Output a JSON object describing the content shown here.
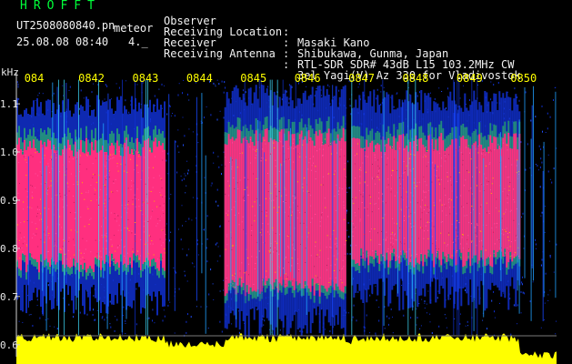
{
  "header": {
    "logo": "HROFFT",
    "filename": "UT2508080840.pn",
    "filename_suffix": "meteor",
    "timestamp": "25.08.08 08:40",
    "timestamp_extra": "4._",
    "meta": [
      {
        "label": "Observer",
        "value": "Masaki Kano"
      },
      {
        "label": "Receiving Location",
        "value": "Shibukawa, Gunma, Japan"
      },
      {
        "label": "Receiver",
        "value": "RTL-SDR SDR# 43dB L15 103.2MHz CW"
      },
      {
        "label": "Receiving Antenna",
        "value": "3el Yagi(V) Az 330 for Vladivostok"
      }
    ],
    "separator": ":"
  },
  "colors": {
    "background": "#000000",
    "label_text": "#f2f2f2",
    "logo": "#00ff3a",
    "time_ticks": "#ffff00",
    "signal_strong": "#ff2f7f",
    "signal_mid": "#33dd55",
    "signal_low": "#1030d0",
    "amplitude_trace": "#ffff00"
  },
  "chart_data": {
    "type": "heatmap",
    "ylabel": "kHz",
    "y_ticks": [
      "1.1",
      "1.0",
      "0.9",
      "0.8",
      "0.7",
      "0.6"
    ],
    "ylim": [
      0.58,
      1.16
    ],
    "x_ticks": [
      "084",
      "0842",
      "0843",
      "0844",
      "0845",
      "0846",
      "0847",
      "0848",
      "0849",
      "0850"
    ],
    "xlim": [
      0,
      10
    ],
    "grid": false,
    "activity_blocks": [
      {
        "start": 0.0,
        "end": 2.75,
        "fmin": 0.77,
        "fmax": 1.01
      },
      {
        "start": 3.85,
        "end": 6.1,
        "fmin": 0.72,
        "fmax": 1.03
      },
      {
        "start": 6.2,
        "end": 9.3,
        "fmin": 0.78,
        "fmax": 1.02
      }
    ]
  }
}
